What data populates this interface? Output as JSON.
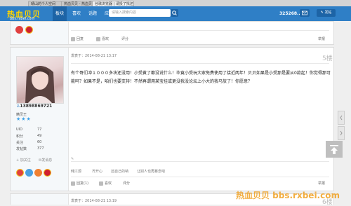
{
  "browser": {
    "tabs": [
      "晴山的个人空间",
      "热血贝贝 - 热血贝贝",
      "谷歌浏览器 | 请投了找还以上"
    ]
  },
  "site": {
    "logo_text": "热血贝贝",
    "logo_url": "bbs.rxbei.com",
    "nav": [
      "板块",
      "喜欢",
      "话题",
      "应用"
    ],
    "search_placeholder": "请输入搜索内容",
    "user": "325268...",
    "post_button": "发帖"
  },
  "posts": [
    {
      "footer": {
        "rate": "回复",
        "like": "喜欢",
        "score": "评分",
        "report": "举报"
      }
    },
    {
      "floor": "5楼",
      "posted": "发表于：2014-08-21 13:17",
      "author_id": "13898869721",
      "rank": "精灵王",
      "stats": [
        {
          "label": "UID",
          "value": "77"
        },
        {
          "label": "积分",
          "value": "49"
        },
        {
          "label": "关注",
          "value": "60"
        },
        {
          "label": "发帖数",
          "value": "377"
        }
      ],
      "follow": "+ 加关注",
      "message": "发消息",
      "body": "有个哥们冲１０００多块还没用！小受黄了都没说什么！毕竟小受玩大家免费使用了接近两年！贝贝如果是小受那是要从0款起！你觉得那可能吗？如果不是，咱们也要支持！不然再谓用某宝挂或更没我没论坛上小大的我马放了！你愿意？",
      "sig_links": [
        "韩江源",
        "齐开心",
        "还自己的呐",
        "让别人也再暴念吧"
      ],
      "footer": {
        "reply": "回复(1)",
        "like": "喜欢",
        "score": "评分",
        "report": "举报"
      }
    },
    {
      "posted": "发表于：2014-08-21 13:19",
      "floor": "6楼"
    }
  ],
  "watermark": "热血贝贝 bbs.rxbei.com"
}
